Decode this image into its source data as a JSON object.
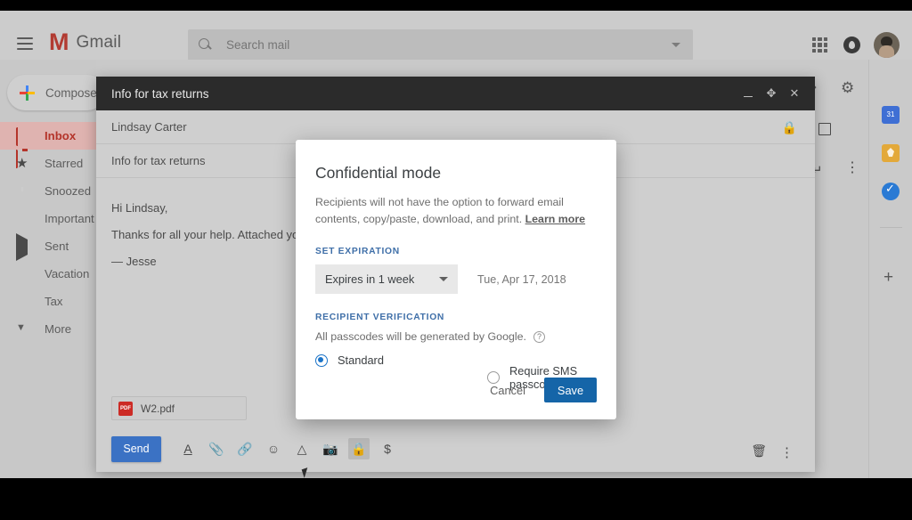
{
  "header": {
    "menu_icon": "hamburger-icon",
    "logo_mark": "M",
    "logo_text": "Gmail",
    "search_placeholder": "Search mail",
    "search_value": "",
    "apps_icon": "apps-grid-icon",
    "support_icon": "support-icon",
    "avatar": "user-avatar"
  },
  "sidebar": {
    "compose_label": "Compose",
    "items": [
      {
        "label": "Inbox",
        "icon": "inbox-icon",
        "active": true
      },
      {
        "label": "Starred",
        "icon": "star-icon",
        "active": false
      },
      {
        "label": "Snoozed",
        "icon": "clock-icon",
        "active": false
      },
      {
        "label": "Important",
        "icon": "important-icon",
        "active": false
      },
      {
        "label": "Sent",
        "icon": "sent-icon",
        "active": false
      },
      {
        "label": "Vacation",
        "icon": "label-chip-icon",
        "color": "#7ecfae",
        "active": false
      },
      {
        "label": "Tax",
        "icon": "label-chip-icon",
        "color": "#8f7fd4",
        "active": false
      },
      {
        "label": "More",
        "icon": "chevron-down-icon",
        "active": false
      }
    ]
  },
  "rail": {
    "calendar_label": "31",
    "items": [
      "calendar-icon",
      "keep-icon",
      "tasks-icon",
      "add-icon"
    ]
  },
  "compose": {
    "title": "Info for tax returns",
    "recipient": "Lindsay Carter",
    "subject": "Info for tax returns",
    "body_lines": [
      "Hi Lindsay,",
      "Thanks for all your help. Attached you'll fin",
      "— Jesse"
    ],
    "attachment": {
      "name": "W2.pdf",
      "type_label": "PDF"
    },
    "send_label": "Send",
    "toolbar_icons": [
      "format-text-icon",
      "attach-file-icon",
      "insert-link-icon",
      "insert-emoji-icon",
      "google-drive-icon",
      "insert-photo-icon",
      "confidential-mode-icon",
      "insert-money-icon"
    ],
    "trash_icon": "delete-draft-icon",
    "more_icon": "more-options-icon",
    "window_controls": [
      "minimize-icon",
      "expand-icon",
      "close-icon"
    ]
  },
  "pane_icons": [
    "print-icon",
    "open-in-new-icon",
    "reply-icon",
    "more-vertical-icon",
    "lock-icon",
    "settings-gear-icon",
    "chevron-right-icon"
  ],
  "dialog": {
    "title": "Confidential mode",
    "description": "Recipients will not have the option to forward email contents, copy/paste, download, and print.",
    "learn_more": "Learn more",
    "expiration_label": "SET EXPIRATION",
    "expiration_value": "Expires in 1 week",
    "expiration_date": "Tue, Apr 17, 2018",
    "verification_label": "RECIPIENT VERIFICATION",
    "passcode_note": "All passcodes will be generated by Google.",
    "help_icon": "help-circle-icon",
    "radio_standard": "Standard",
    "radio_sms": "Require SMS passcode",
    "selected_option": "Standard",
    "cancel_label": "Cancel",
    "save_label": "Save",
    "accent_color": "#1565a8",
    "section_label_color": "#3f6fa8"
  }
}
